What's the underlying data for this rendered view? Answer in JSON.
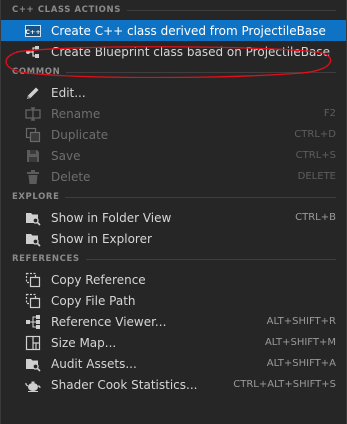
{
  "sections": {
    "cpp_actions": "C++ CLASS ACTIONS",
    "common": "COMMON",
    "explore": "EXPLORE",
    "references": "REFERENCES"
  },
  "items": {
    "create_cpp": {
      "label": "Create C++ class derived from ProjectileBase",
      "icon": "cpp-file-icon"
    },
    "create_bp": {
      "label": "Create Blueprint class based on ProjectileBase",
      "icon": "blueprint-graph-icon"
    },
    "edit": {
      "label": "Edit...",
      "icon": "pencil-icon"
    },
    "rename": {
      "label": "Rename",
      "shortcut": "F2",
      "icon": "rename-icon"
    },
    "duplicate": {
      "label": "Duplicate",
      "shortcut": "CTRL+D",
      "icon": "duplicate-icon"
    },
    "save": {
      "label": "Save",
      "shortcut": "CTRL+S",
      "icon": "save-icon"
    },
    "delete": {
      "label": "Delete",
      "shortcut": "DELETE",
      "icon": "trash-icon"
    },
    "show_folder": {
      "label": "Show in Folder View",
      "shortcut": "CTRL+B",
      "icon": "folder-search-icon"
    },
    "show_explorer": {
      "label": "Show in Explorer",
      "icon": "folder-search-icon"
    },
    "copy_ref": {
      "label": "Copy Reference",
      "icon": "copy-icon"
    },
    "copy_path": {
      "label": "Copy File Path",
      "icon": "copy-icon"
    },
    "ref_viewer": {
      "label": "Reference Viewer...",
      "shortcut": "ALT+SHIFT+R",
      "icon": "reference-viewer-icon"
    },
    "size_map": {
      "label": "Size Map...",
      "shortcut": "ALT+SHIFT+M",
      "icon": "size-map-icon"
    },
    "audit": {
      "label": "Audit Assets...",
      "shortcut": "ALT+SHIFT+A",
      "icon": "audit-icon"
    },
    "shader_cook": {
      "label": "Shader Cook Statistics...",
      "shortcut": "CTRL+ALT+SHIFT+S",
      "icon": "teapot-icon"
    }
  },
  "colors": {
    "background": "#262626",
    "selected": "#0e73c4",
    "annotation": "#e0101a"
  }
}
